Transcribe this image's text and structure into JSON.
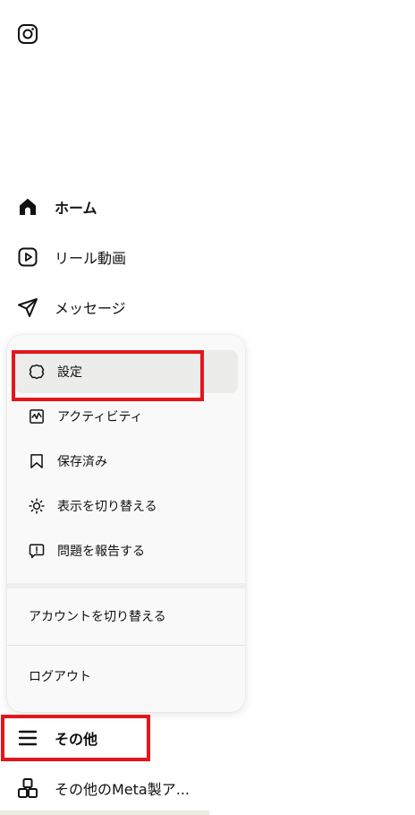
{
  "app": {
    "logo_icon": "instagram-icon"
  },
  "nav": {
    "home": {
      "label": "ホーム",
      "icon": "home-icon"
    },
    "reels": {
      "label": "リール動画",
      "icon": "reels-icon"
    },
    "messages": {
      "label": "メッセージ",
      "icon": "send-icon"
    },
    "more": {
      "label": "その他",
      "icon": "menu-icon"
    },
    "meta": {
      "label": "その他のMeta製ア...",
      "icon": "apps-icon"
    }
  },
  "more_menu": {
    "items": [
      {
        "label": "設定",
        "icon": "gear-icon"
      },
      {
        "label": "アクティビティ",
        "icon": "activity-icon"
      },
      {
        "label": "保存済み",
        "icon": "bookmark-icon"
      },
      {
        "label": "表示を切り替える",
        "icon": "sun-icon"
      },
      {
        "label": "問題を報告する",
        "icon": "report-icon"
      }
    ],
    "switch_account": "アカウントを切り替える",
    "logout": "ログアウト"
  },
  "highlight_color": "#e3161b"
}
